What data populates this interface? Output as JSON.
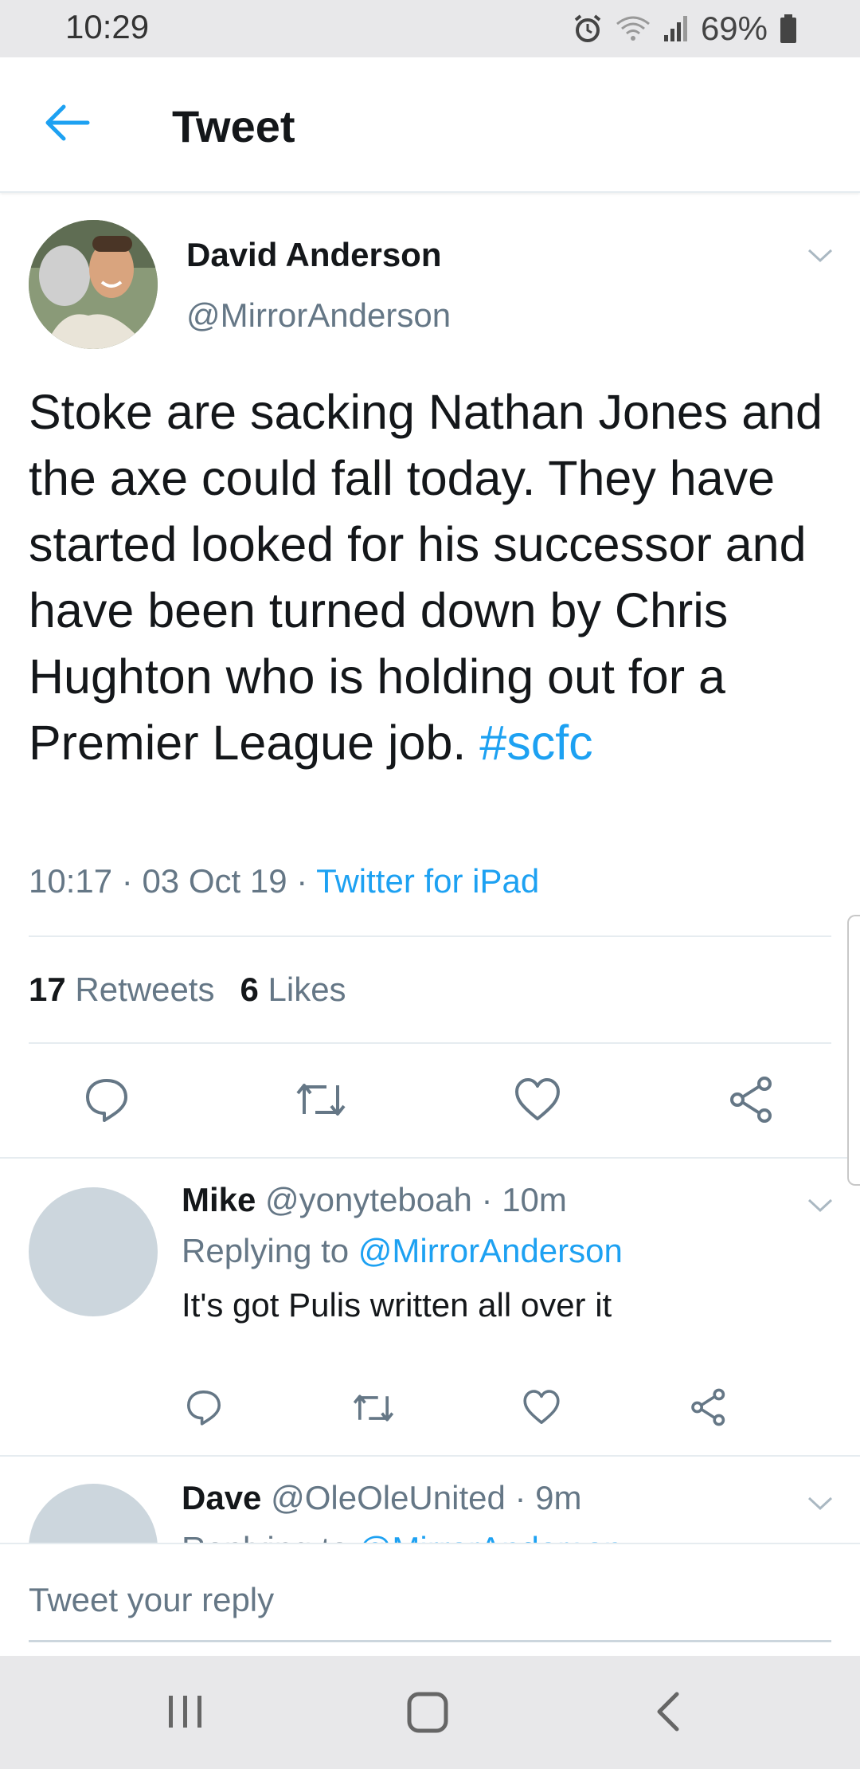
{
  "status_bar": {
    "time": "10:29",
    "battery": "69%"
  },
  "header": {
    "title": "Tweet"
  },
  "tweet": {
    "author_name": "David Anderson",
    "author_handle": "@MirrorAnderson",
    "text": "Stoke are sacking Nathan Jones and the axe could fall today. They have started looked for his successor and have been turned down by Chris Hughton who is holding out for a Premier League job.",
    "hashtag": "#scfc",
    "time": "10:17",
    "date": "03 Oct 19",
    "source": "Twitter for iPad",
    "retweet_count": "17",
    "retweet_label": "Retweets",
    "like_count": "6",
    "like_label": "Likes"
  },
  "replies": [
    {
      "name": "Mike",
      "handle": "@yonyteboah",
      "age": "10m",
      "replying_label": "Replying to",
      "replying_to": "@MirrorAnderson",
      "text": "It's got Pulis written all over it"
    },
    {
      "name": "Dave",
      "handle": "@OleOleUnited",
      "age": "9m",
      "replying_label": "Replying to",
      "replying_to": "@MirrorAnderson"
    }
  ],
  "compose": {
    "placeholder": "Tweet your reply"
  },
  "colors": {
    "accent": "#1da1f2",
    "secondary_text": "#657786",
    "primary_text": "#14171a"
  }
}
